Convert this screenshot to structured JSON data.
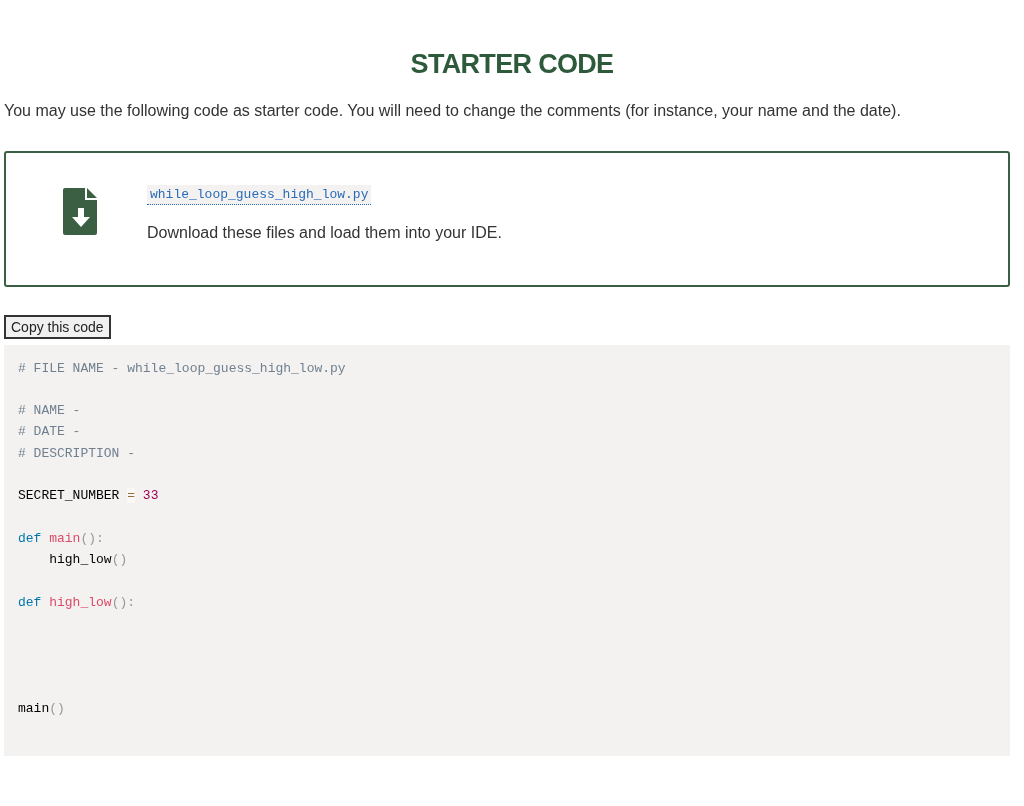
{
  "heading": "STARTER CODE",
  "intro": "You may use the following code as starter code. You will need to change the comments (for instance, your name and the date).",
  "download_card": {
    "file_link": "while_loop_guess_high_low.py",
    "instruction": "Download these files and load them into your IDE."
  },
  "copy_button": "Copy this code",
  "code_lines": [
    {
      "kind": "code",
      "tokens": [
        {
          "kind": "comment",
          "text": "# FILE NAME - while_loop_guess_high_low.py"
        }
      ]
    },
    {
      "kind": "blank"
    },
    {
      "kind": "code",
      "tokens": [
        {
          "kind": "comment",
          "text": "# NAME -"
        }
      ]
    },
    {
      "kind": "code",
      "tokens": [
        {
          "kind": "comment",
          "text": "# DATE -"
        }
      ]
    },
    {
      "kind": "code",
      "tokens": [
        {
          "kind": "comment",
          "text": "# DESCRIPTION -"
        }
      ]
    },
    {
      "kind": "blank"
    },
    {
      "kind": "code",
      "tokens": [
        {
          "kind": "plain",
          "text": "SECRET_NUMBER "
        },
        {
          "kind": "operator",
          "text": "="
        },
        {
          "kind": "number",
          "text": " 33"
        }
      ]
    },
    {
      "kind": "blank"
    },
    {
      "kind": "code",
      "tokens": [
        {
          "kind": "keyword",
          "text": "def "
        },
        {
          "kind": "function",
          "text": "main"
        },
        {
          "kind": "punctuation",
          "text": "():"
        }
      ]
    },
    {
      "kind": "code",
      "tokens": [
        {
          "kind": "plain",
          "text": "    high_low"
        },
        {
          "kind": "punctuation",
          "text": "()"
        }
      ]
    },
    {
      "kind": "blank"
    },
    {
      "kind": "code",
      "tokens": [
        {
          "kind": "keyword",
          "text": "def "
        },
        {
          "kind": "function",
          "text": "high_low"
        },
        {
          "kind": "punctuation",
          "text": "():"
        }
      ]
    },
    {
      "kind": "blank"
    },
    {
      "kind": "blank"
    },
    {
      "kind": "blank"
    },
    {
      "kind": "blank"
    },
    {
      "kind": "code",
      "tokens": [
        {
          "kind": "plain",
          "text": "main"
        },
        {
          "kind": "punctuation",
          "text": "()"
        }
      ]
    }
  ]
}
